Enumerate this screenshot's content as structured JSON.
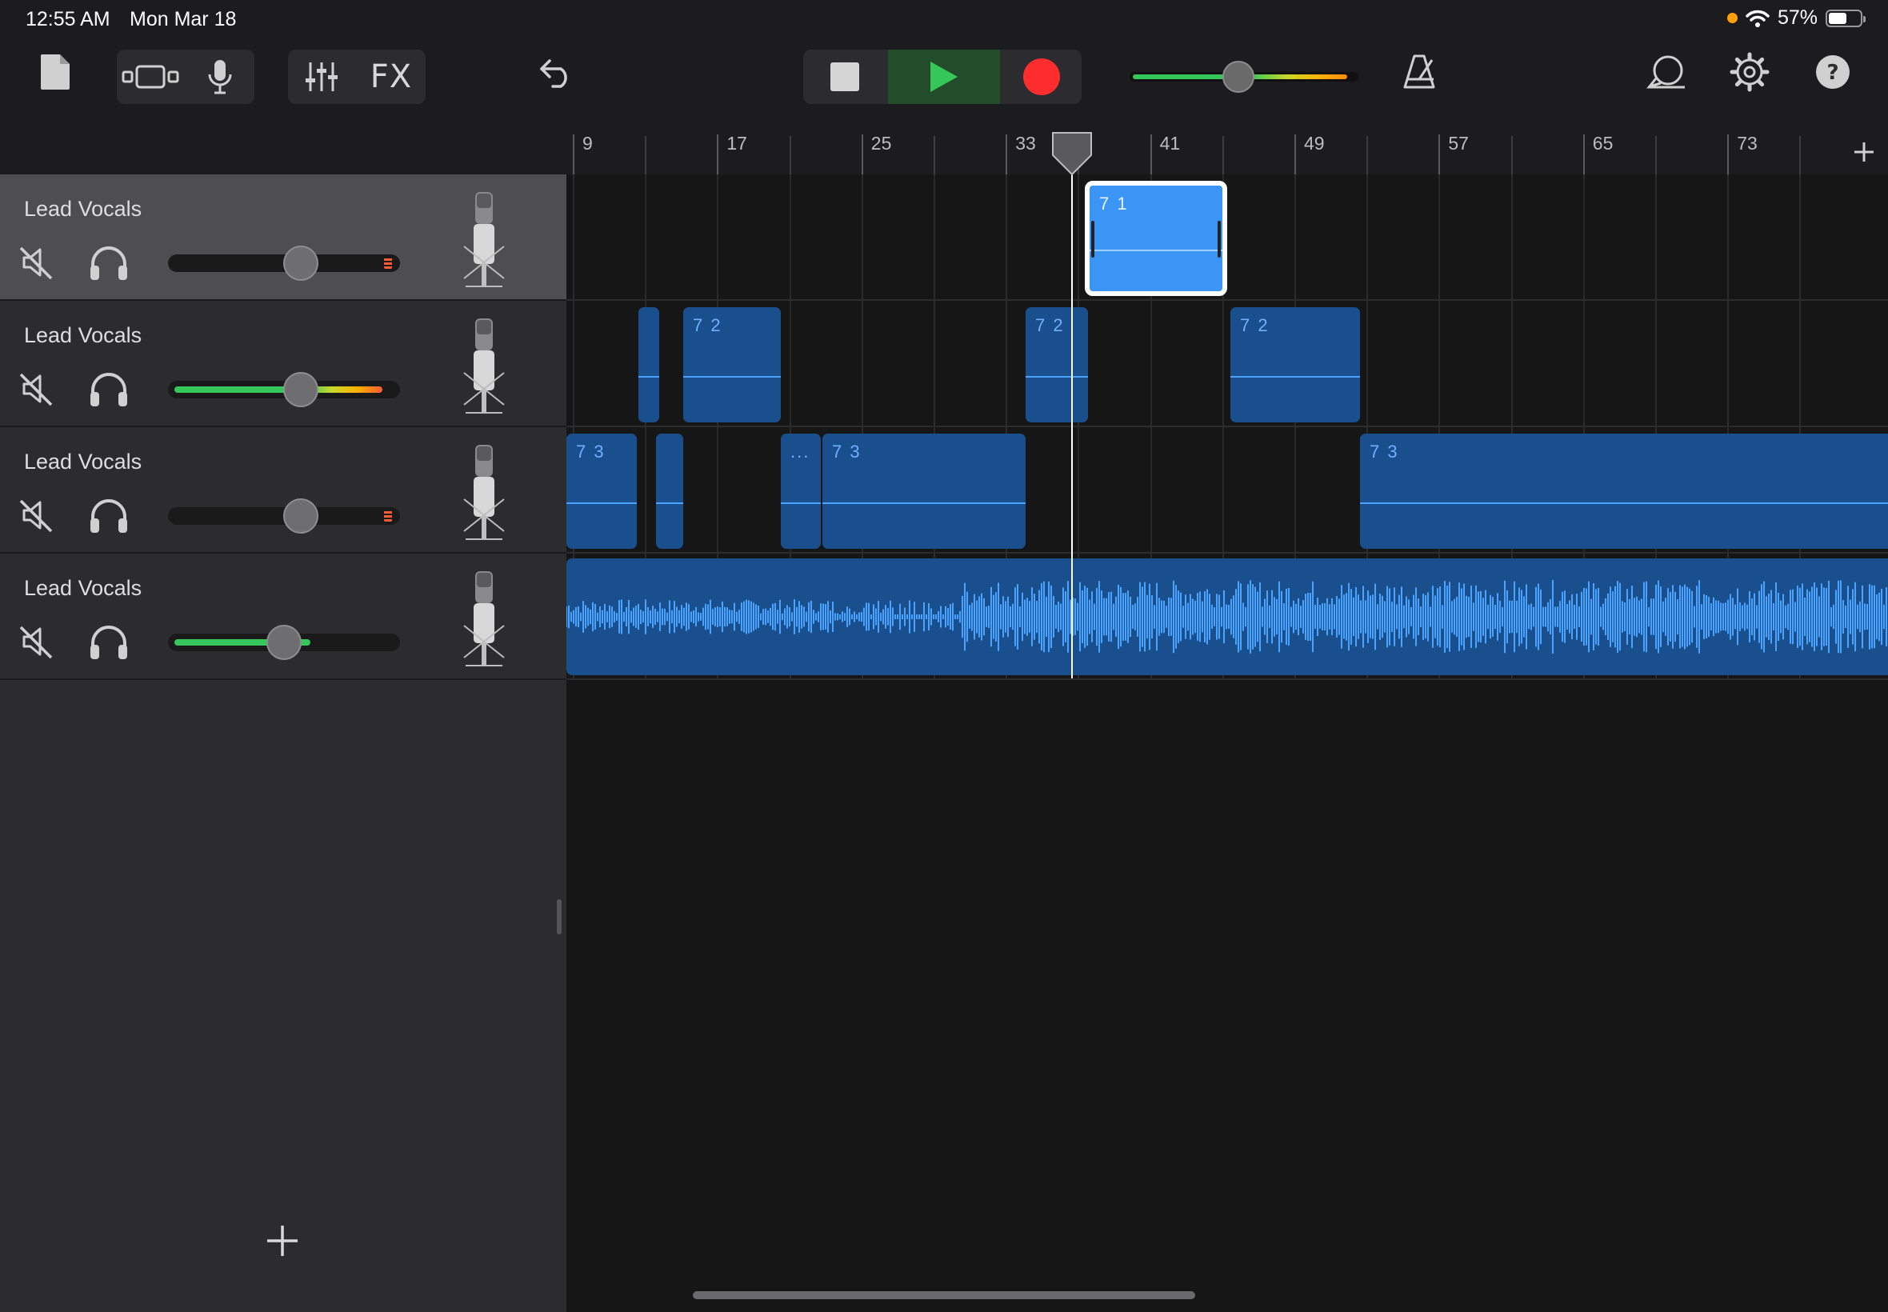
{
  "status_bar": {
    "time": "12:55 AM",
    "date": "Mon Mar 18",
    "battery_pct": "57%",
    "battery_level": 0.57,
    "privacy_dot_color": "#ff9f0a"
  },
  "toolbar": {
    "fx_label": "FX",
    "master_volume_level": 0.47,
    "icons": [
      "document-icon",
      "track-view-icon",
      "microphone-icon",
      "mixer-sliders-icon",
      "undo-icon",
      "stop-icon",
      "play-icon",
      "record-icon",
      "metronome-icon",
      "loop-icon",
      "settings-gear-icon",
      "help-icon"
    ],
    "play_color": "#35c759",
    "record_color": "#ff2d2d"
  },
  "ruler": {
    "bar_labels": [
      "9",
      "17",
      "25",
      "33",
      "41",
      "49",
      "57",
      "65",
      "73"
    ]
  },
  "tracks": [
    {
      "name": "Lead Vocals",
      "volume": 0.62,
      "meter_level": 0.0,
      "selected": true,
      "regions": [
        {
          "label": "7 1",
          "selected": true
        }
      ]
    },
    {
      "name": "Lead Vocals",
      "volume": 0.62,
      "meter_level": 0.95,
      "selected": false,
      "regions": [
        {
          "label": ""
        },
        {
          "label": "7 2"
        },
        {
          "label": "7 2"
        },
        {
          "label": "7 2"
        }
      ]
    },
    {
      "name": "Lead Vocals",
      "volume": 0.62,
      "meter_level": 0.0,
      "selected": false,
      "regions": [
        {
          "label": "7 3"
        },
        {
          "label": ""
        },
        {
          "label": "..."
        },
        {
          "label": "7 3"
        },
        {
          "label": "7 3"
        }
      ]
    },
    {
      "name": "Lead Vocals",
      "volume": 0.55,
      "meter_level": 0.62,
      "selected": false,
      "regions": [
        {
          "label": ""
        }
      ]
    }
  ],
  "colors": {
    "region": "#1a4f8e",
    "region_selected": "#3a95f4",
    "waveform": "#4aa3ff",
    "meter_green": "#35c759",
    "meter_peak": "#ff5a36"
  }
}
